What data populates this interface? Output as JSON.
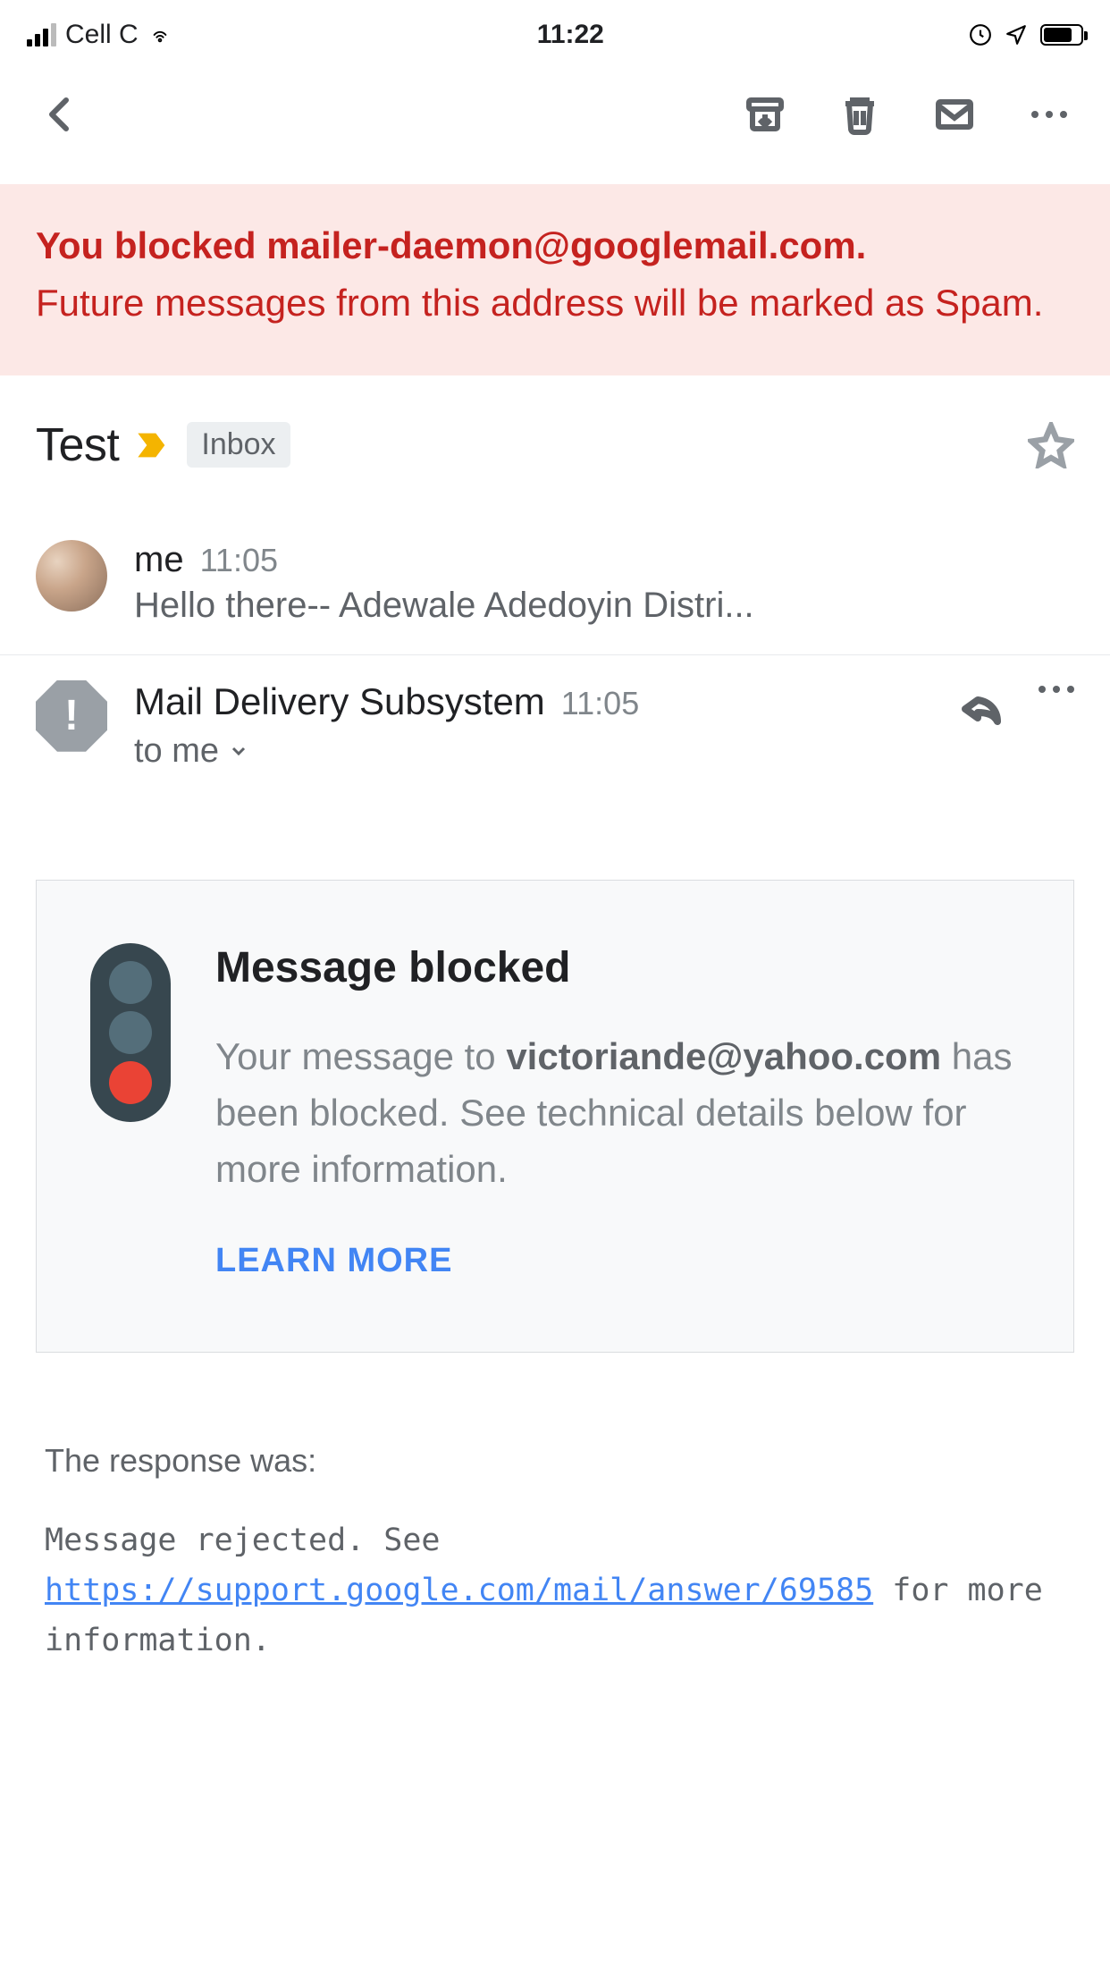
{
  "status": {
    "carrier": "Cell C",
    "time": "11:22"
  },
  "banner": {
    "title": "You blocked mailer-daemon@googlemail.com.",
    "subtitle": "Future messages from this address will be marked as Spam."
  },
  "subject": "Test",
  "label": "Inbox",
  "thread": {
    "msg1": {
      "sender": "me",
      "time": "11:05",
      "snippet": "Hello there-- Adewale Adedoyin Distri..."
    },
    "msg2": {
      "sender": "Mail Delivery Subsystem",
      "time": "11:05",
      "recipient": "to me"
    }
  },
  "card": {
    "title": "Message blocked",
    "text_pre": "Your message to ",
    "email": "victoriande@yahoo.com",
    "text_post": " has been blocked. See technical details below for more information.",
    "learn_more": "LEARN MORE"
  },
  "response": {
    "label": "The response was:",
    "prefix": "Message rejected. See ",
    "link": "https://support.google.com/mail/answer/69585",
    "suffix": " for more information."
  }
}
